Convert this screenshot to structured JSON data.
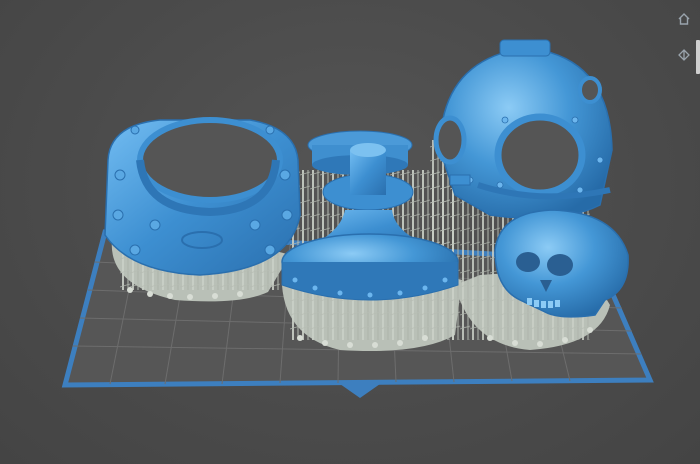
{
  "app": {
    "view": "3d-print-preparation-viewport",
    "icons": {
      "home": "home-icon",
      "front_view": "front-view-icon"
    },
    "colors": {
      "background": "#4a4a4a",
      "model": "#3d8fd1",
      "model_highlight": "#6cb6ee",
      "supports": "#c9cfc6",
      "raft": "#b8bfb6",
      "build_plate": "#555555",
      "build_plate_border": "#3d7fbf",
      "grid": "#6a6a6a",
      "ui_icon": "#9aa4ad"
    }
  },
  "scene": {
    "objects": [
      {
        "name": "diving-helmet-collar"
      },
      {
        "name": "pedestal-base"
      },
      {
        "name": "diving-helmet"
      },
      {
        "name": "skull"
      }
    ]
  }
}
